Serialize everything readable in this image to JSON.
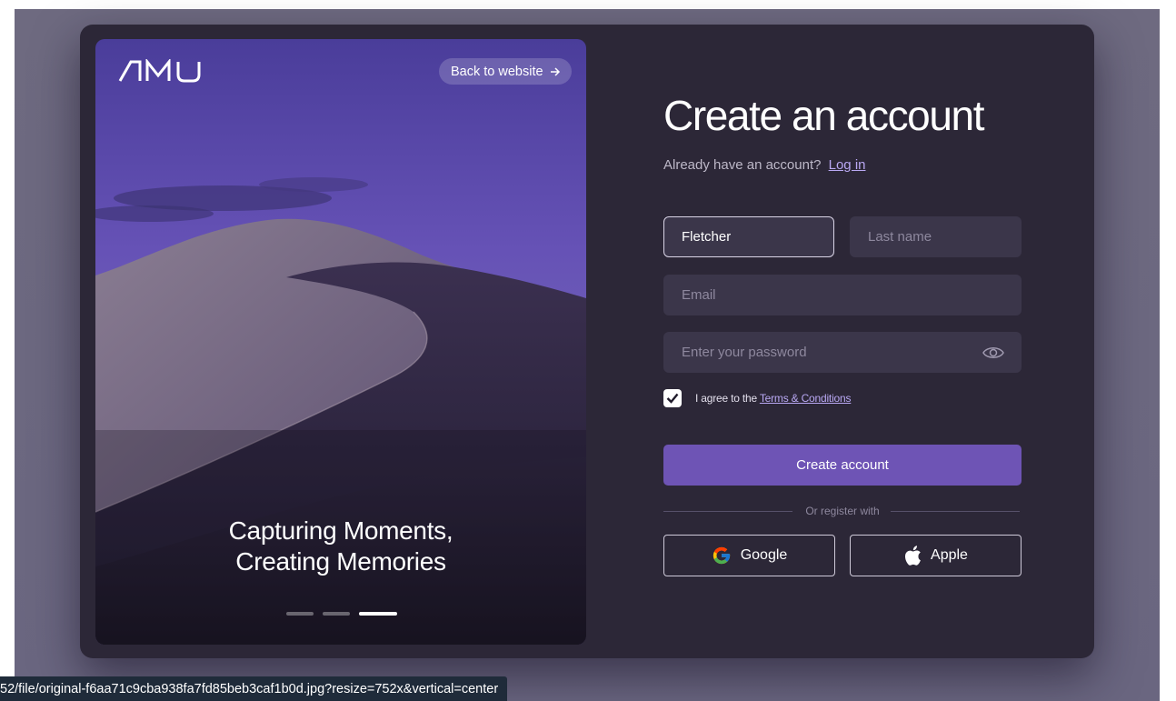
{
  "brand": {
    "logo_text": "AMU"
  },
  "hero": {
    "back_link": "Back to website",
    "tagline_line1": "Capturing Moments,",
    "tagline_line2": "Creating Memories",
    "carousel_active_index": 3,
    "carousel_count": 3
  },
  "form": {
    "title": "Create an account",
    "have_account": "Already have an account?",
    "login_link": "Log in",
    "first_name_value": "Fletcher",
    "last_name_placeholder": "Last name",
    "email_placeholder": "Email",
    "password_placeholder": "Enter your password",
    "agree_prefix": "I agree to the",
    "terms_link": "Terms & Conditions",
    "agree_checked": true,
    "submit_label": "Create account",
    "divider_text": "Or register with",
    "google_label": "Google",
    "apple_label": "Apple"
  },
  "colors": {
    "card_bg": "#2c2737",
    "field_bg": "#3b364a",
    "accent": "#6e54b5",
    "link": "#b9a8f3"
  },
  "status_bar": {
    "url": "52/file/original-f6aa71c9cba938fa7fd85beb3caf1b0d.jpg?resize=752x&vertical=center"
  }
}
